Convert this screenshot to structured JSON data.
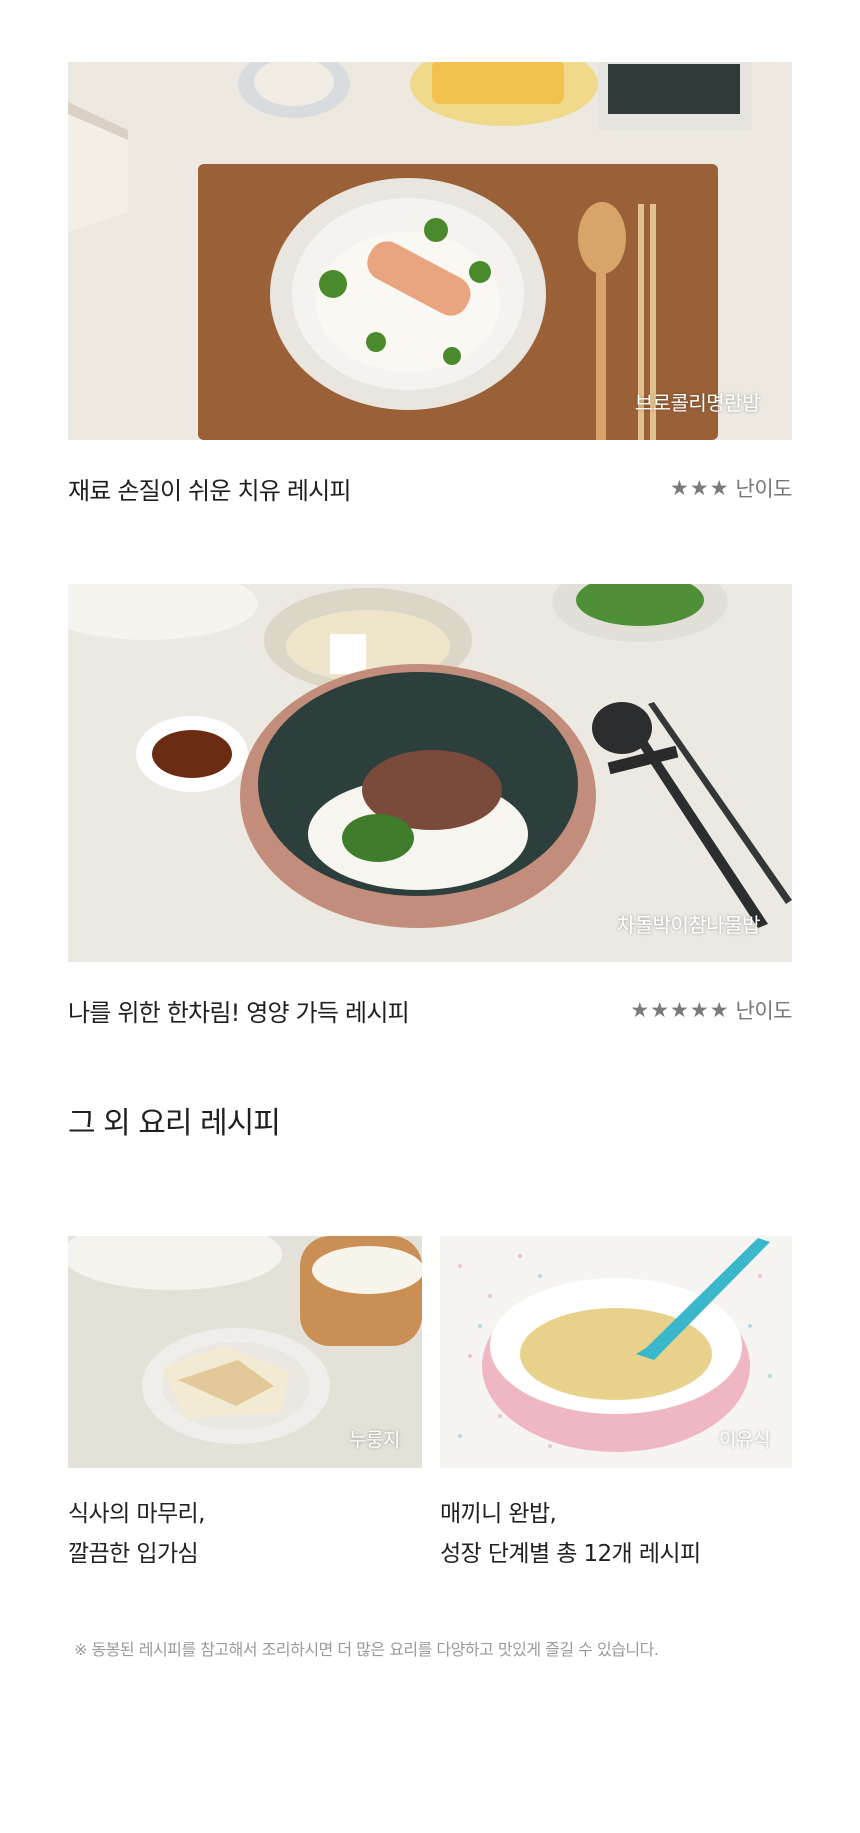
{
  "recipes": [
    {
      "photo_label": "브로콜리명란밥",
      "title": "재료 손질이 쉬운 치유 레시피",
      "stars": "★★★",
      "difficulty_label": "난이도"
    },
    {
      "photo_label": "차돌박이참나물밥",
      "title": "나를 위한 한차림! 영양 가득 레시피",
      "stars": "★★★★★",
      "difficulty_label": "난이도"
    }
  ],
  "other_section": {
    "title": "그 외 요리 레시피",
    "items": [
      {
        "photo_label": "누룽지",
        "caption_line1": "식사의 마무리,",
        "caption_line2": "깔끔한 입가심"
      },
      {
        "photo_label": "이유식",
        "caption_line1": "매끼니 완밥,",
        "caption_line2": "성장 단계별 총 12개 레시피"
      }
    ]
  },
  "footnote": "※ 동봉된 레시피를 참고해서 조리하시면 더 많은 요리를 다양하고 맛있게 즐길 수 있습니다."
}
